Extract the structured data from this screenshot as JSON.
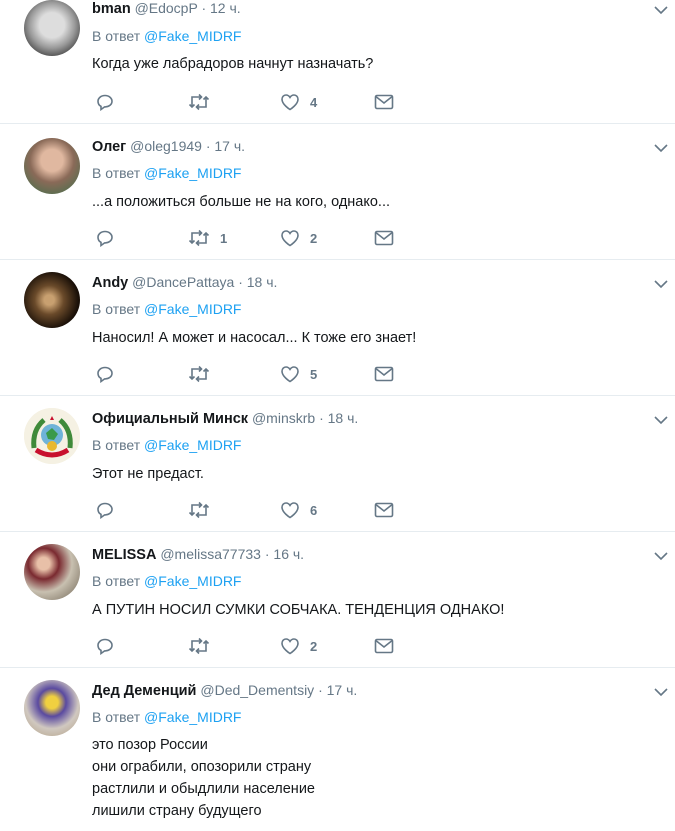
{
  "tweets": [
    {
      "name": "bman",
      "handle": "@EdocpP",
      "time": "12 ч.",
      "reply_prefix": "В ответ",
      "reply_to": "@Fake_MIDRF",
      "lines": [
        "Когда уже лабрадоров начнут назначать?"
      ],
      "replies": "",
      "retweets": "",
      "likes": "4"
    },
    {
      "name": "Олег",
      "handle": "@oleg1949",
      "time": "17 ч.",
      "reply_prefix": "В ответ",
      "reply_to": "@Fake_MIDRF",
      "lines": [
        "...а положиться больше не на кого, однако..."
      ],
      "replies": "",
      "retweets": "1",
      "likes": "2"
    },
    {
      "name": "Andy",
      "handle": "@DancePattaya",
      "time": "18 ч.",
      "reply_prefix": "В ответ",
      "reply_to": "@Fake_MIDRF",
      "lines": [
        "Наносил! А может и насосал... К тоже его знает!"
      ],
      "replies": "",
      "retweets": "",
      "likes": "5"
    },
    {
      "name": "Официальный Минск",
      "handle": "@minskrb",
      "time": "18 ч.",
      "reply_prefix": "В ответ",
      "reply_to": "@Fake_MIDRF",
      "lines": [
        "Этот не предаст."
      ],
      "replies": "",
      "retweets": "",
      "likes": "6"
    },
    {
      "name": "MELISSA",
      "handle": "@melissa77733",
      "time": "16 ч.",
      "reply_prefix": "В ответ",
      "reply_to": "@Fake_MIDRF",
      "lines": [
        "А ПУТИН НОСИЛ СУМКИ СОБЧАКА. ТЕНДЕНЦИЯ ОДНАКО!"
      ],
      "replies": "",
      "retweets": "",
      "likes": "2"
    },
    {
      "name": "Дед Деменций",
      "handle": "@Ded_Dementsiy",
      "time": "17 ч.",
      "reply_prefix": "В ответ",
      "reply_to": "@Fake_MIDRF",
      "lines": [
        "это позор России",
        "они ограбили, опозорили страну",
        "растлили и обыдлили население",
        "лишили страну будущего"
      ],
      "replies": "",
      "retweets": "",
      "likes": ""
    }
  ],
  "separator": "·",
  "colors": {
    "accent": "#1da1f2",
    "muted": "#657786",
    "text": "#14171a",
    "border": "#e6ecf0"
  }
}
